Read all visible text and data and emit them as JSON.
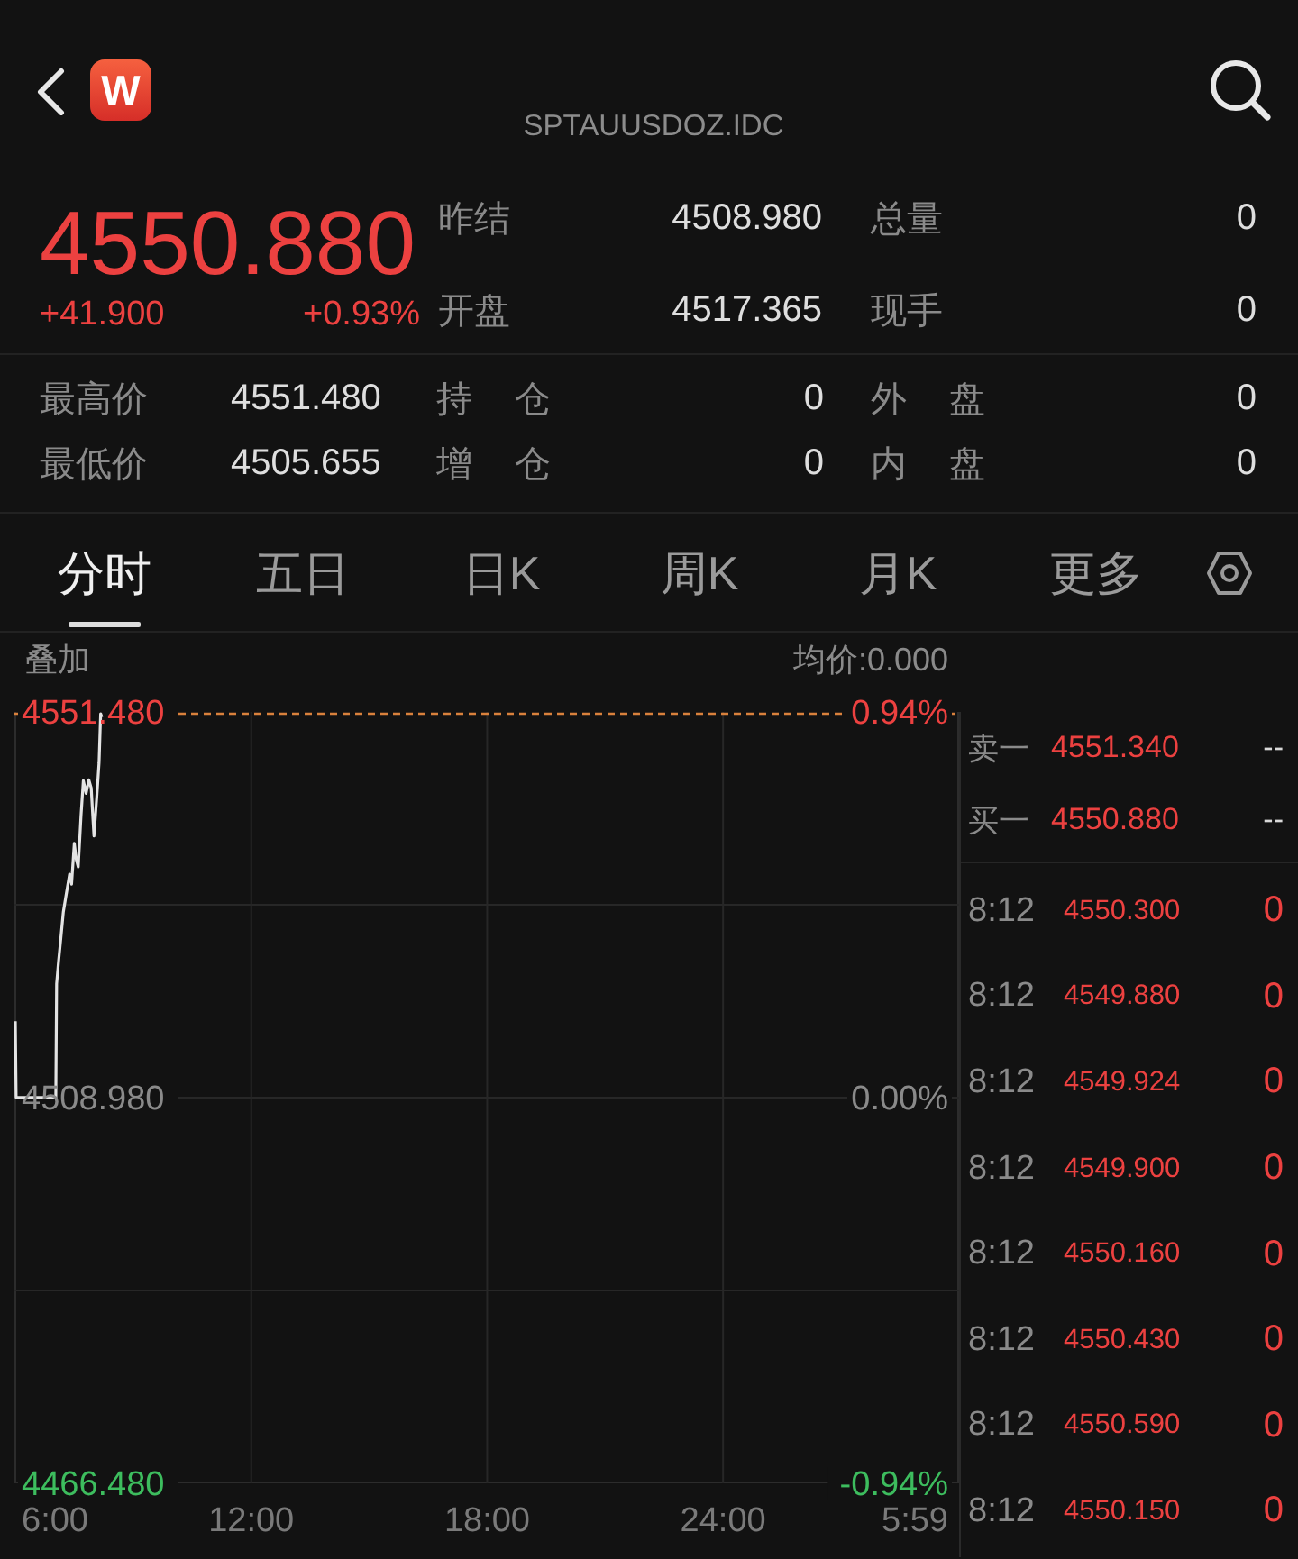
{
  "header": {
    "logo": "W",
    "subtitle": "SPTAUUSDOZ.IDC"
  },
  "quote": {
    "price": "4550.880",
    "change": "+41.900",
    "change_percent": "+0.93%",
    "up": true
  },
  "summary_stats": [
    {
      "label": "昨结",
      "value": "4508.980"
    },
    {
      "label": "总量",
      "value": "0"
    },
    {
      "label": "开盘",
      "value": "4517.365"
    },
    {
      "label": "现手",
      "value": "0"
    }
  ],
  "detail_stats": [
    {
      "cells": [
        {
          "label": "最高价",
          "value": "4551.480"
        },
        {
          "label": "持 仓",
          "value": "0"
        },
        {
          "label": "外 盘",
          "value": "0"
        }
      ]
    },
    {
      "cells": [
        {
          "label": "最低价",
          "value": "4505.655"
        },
        {
          "label": "增 仓",
          "value": "0"
        },
        {
          "label": "内 盘",
          "value": "0"
        }
      ]
    }
  ],
  "tabs": [
    {
      "label": "分时",
      "selected": true
    },
    {
      "label": "五日",
      "selected": false
    },
    {
      "label": "日K",
      "selected": false
    },
    {
      "label": "周K",
      "selected": false
    },
    {
      "label": "月K",
      "selected": false
    },
    {
      "label": "更多",
      "selected": false
    }
  ],
  "chart": {
    "overlay_label": "叠加",
    "average_price": "均价:0.000",
    "percent_ticks": [
      {
        "label": "0.94%",
        "color": "#ec4140"
      },
      {
        "label": "0.00%",
        "color": "#8a8a8a"
      },
      {
        "label": "-0.94%",
        "color": "#3dbd5e"
      }
    ],
    "x_end_label": "5:59",
    "chart_data": {
      "type": "line",
      "x": [
        6,
        6.02,
        7.03,
        7.05,
        7.1,
        7.15,
        7.22,
        7.28,
        7.38,
        7.43,
        7.5,
        7.55,
        7.6,
        7.67,
        7.73,
        7.8,
        7.87,
        7.93,
        7.97,
        8.0,
        8.07,
        8.13,
        8.17,
        8.2
      ],
      "values": [
        4517.4,
        4509.0,
        4509.0,
        4521.5,
        4524.0,
        4526.2,
        4529.4,
        4531.0,
        4533.6,
        4532.5,
        4537.0,
        4535.2,
        4534.4,
        4540.0,
        4543.9,
        4542.5,
        4544.0,
        4543.1,
        4540.0,
        4537.8,
        4542.0,
        4545.9,
        4551.4,
        4550.9
      ],
      "xlim": [
        6,
        29.98
      ],
      "ylim": [
        4466.48,
        4551.48
      ],
      "xticks": [
        {
          "value": 6,
          "label": "6:00"
        },
        {
          "value": 12,
          "label": "12:00"
        },
        {
          "value": 18,
          "label": "18:00"
        },
        {
          "value": 24,
          "label": "24:00"
        }
      ],
      "yticks": [
        {
          "value": 4551.48,
          "label": "4551.480"
        },
        {
          "value": 4508.98,
          "label": "4508.980"
        },
        {
          "value": 4466.48,
          "label": "4466.480"
        }
      ],
      "grid": true
    }
  },
  "order_book": [
    {
      "label": "卖一",
      "price": "4551.340",
      "volume": "--",
      "up": true
    },
    {
      "label": "买一",
      "price": "4550.880",
      "volume": "--",
      "up": true
    }
  ],
  "trades": [
    {
      "time": "8:12",
      "price": "4550.300",
      "volume": "0",
      "up": true
    },
    {
      "time": "8:12",
      "price": "4549.880",
      "volume": "0",
      "up": true
    },
    {
      "time": "8:12",
      "price": "4549.924",
      "volume": "0",
      "up": true
    },
    {
      "time": "8:12",
      "price": "4549.900",
      "volume": "0",
      "up": true
    },
    {
      "time": "8:12",
      "price": "4550.160",
      "volume": "0",
      "up": true
    },
    {
      "time": "8:12",
      "price": "4550.430",
      "volume": "0",
      "up": true
    },
    {
      "time": "8:12",
      "price": "4550.590",
      "volume": "0",
      "up": true
    },
    {
      "time": "8:12",
      "price": "4550.150",
      "volume": "0",
      "up": true
    }
  ]
}
